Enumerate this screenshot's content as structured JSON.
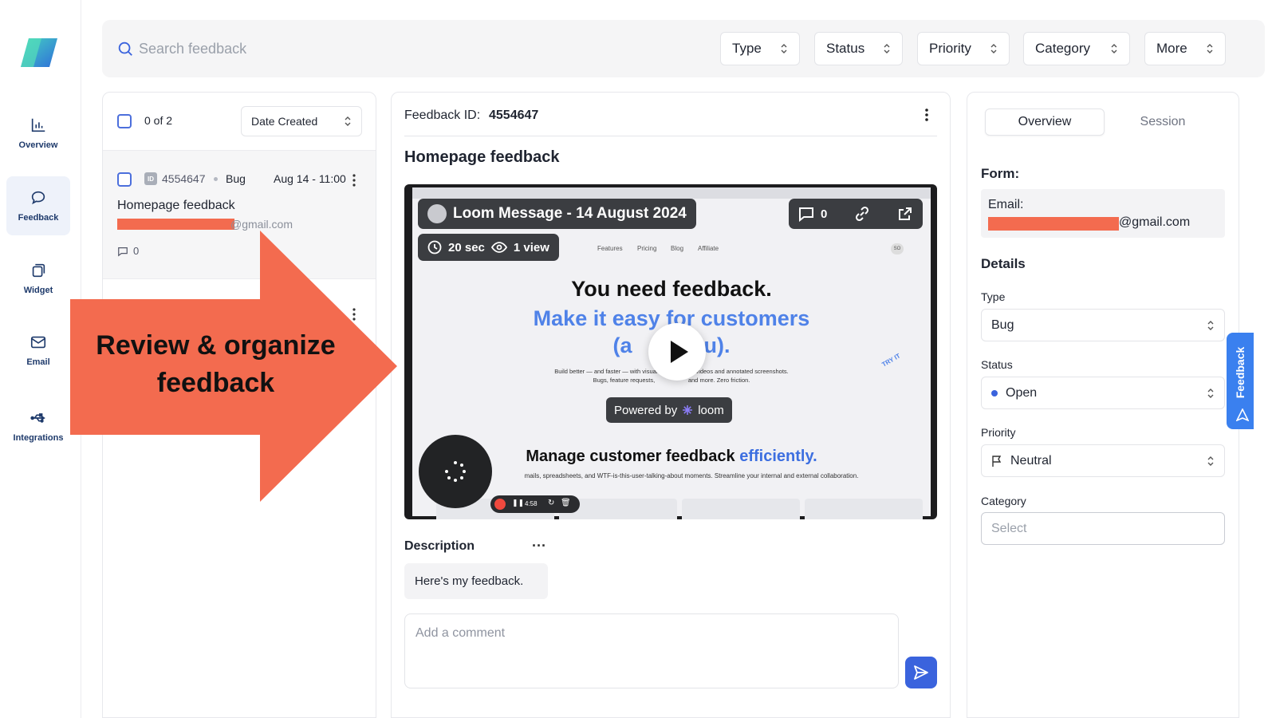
{
  "sidebar": {
    "items": [
      {
        "label": "Overview",
        "icon": "bar-chart-icon"
      },
      {
        "label": "Feedback",
        "icon": "chat-bubble-icon",
        "active": true
      },
      {
        "label": "Widget",
        "icon": "widget-icon"
      },
      {
        "label": "Email",
        "icon": "mail-icon"
      },
      {
        "label": "Integrations",
        "icon": "usb-icon"
      }
    ]
  },
  "toolbar": {
    "search_placeholder": "Search feedback",
    "filters": [
      "Type",
      "Status",
      "Priority",
      "Category",
      "More"
    ]
  },
  "list": {
    "count": "0 of 2",
    "sort": "Date Created",
    "items": [
      {
        "id": "4554647",
        "type": "Bug",
        "date": "Aug 14 - 11:00",
        "title": "Homepage feedback",
        "email_suffix": "@gmail.com",
        "comments": "0"
      }
    ]
  },
  "callout": {
    "text_line1": "Review & organize",
    "text_line2": "feedback",
    "color": "#f36b4f"
  },
  "detail": {
    "id_label": "Feedback ID:",
    "id_value": "4554647",
    "title": "Homepage feedback",
    "video": {
      "title": "Loom Message - 14 August 2024",
      "comments": "0",
      "duration": "20 sec",
      "views": "1 view",
      "site_nav": [
        "Features",
        "Pricing",
        "Blog",
        "Affiliate"
      ],
      "site_avatar": "SO",
      "headline": "You need feedback.",
      "subheadline": "Make it easy for customers",
      "subheadline2": "(a",
      "subheadline3": "u).",
      "body_line1": "Build better — and faster — with visual",
      "body_line1b": "n videos and annotated screenshots.",
      "body_line2": "Bugs, feature requests,",
      "body_line2b": "and more. Zero friction.",
      "try_it": "TRY IT",
      "powered_by": "Powered by",
      "powered_brand": "loom",
      "manage_prefix": "Manage customer feedback",
      "manage_highlight": "efficiently.",
      "manage_sub": "mails, spreadsheets, and WTF-is-this-user-talking-about moments. Streamline your internal and external collaboration.",
      "rec_time": "4:58"
    },
    "description_label": "Description",
    "description_text": "Here's my feedback.",
    "comment_placeholder": "Add a comment"
  },
  "panel": {
    "tabs": [
      "Overview",
      "Session"
    ],
    "form_label": "Form:",
    "email_label": "Email:",
    "email_suffix": "@gmail.com",
    "details_label": "Details",
    "fields": [
      {
        "label": "Type",
        "value": "Bug"
      },
      {
        "label": "Status",
        "value": "Open"
      },
      {
        "label": "Priority",
        "value": "Neutral"
      },
      {
        "label": "Category",
        "value": "Select"
      }
    ]
  },
  "feedback_tab": "Feedback",
  "colors": {
    "accent": "#3a63dd",
    "feedback_tab": "#3a80ef",
    "redaction": "#f36b4f",
    "nav_text": "#1e3a6b"
  }
}
